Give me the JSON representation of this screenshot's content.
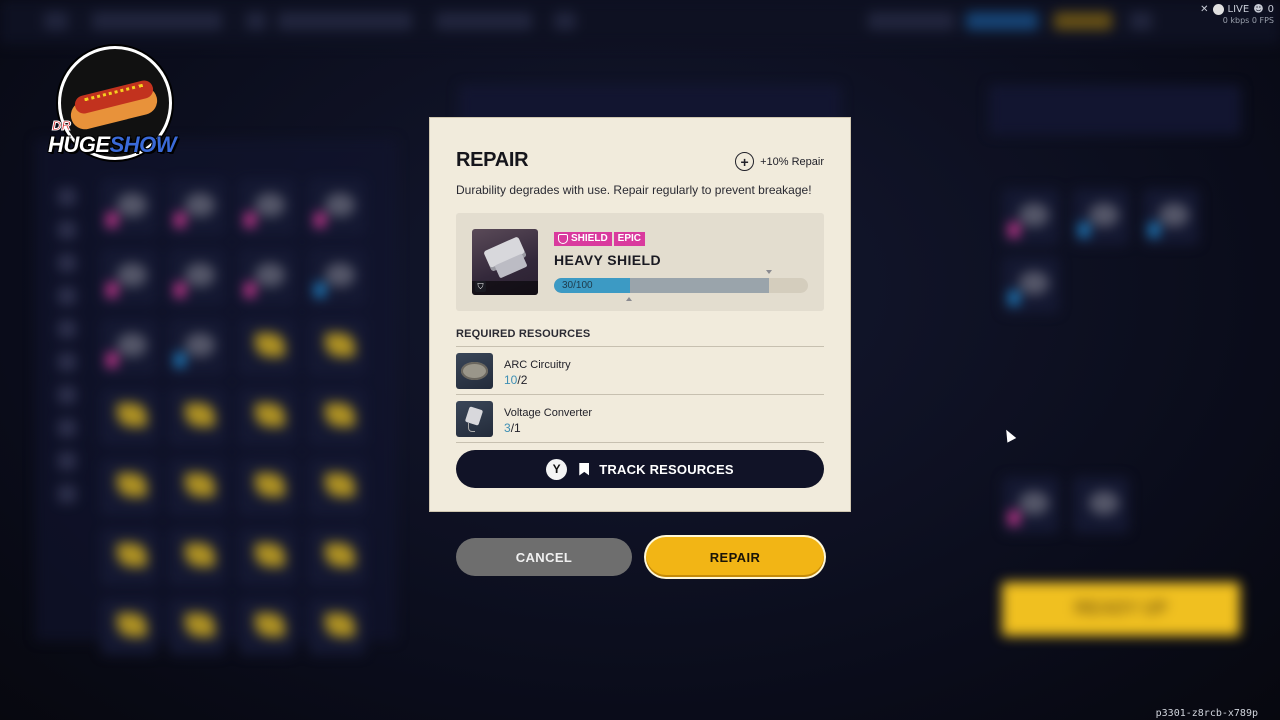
{
  "overlay": {
    "live_label": "LIVE",
    "viewer_count": "0",
    "stats": "0 kbps 0 FPS",
    "session_id": "p3301-z8rcb-x789p"
  },
  "logo": {
    "prefix": "DR",
    "name_part1": "HUGE",
    "name_part2": "SHOW"
  },
  "background": {
    "ready_label": "READY UP"
  },
  "modal": {
    "title": "REPAIR",
    "bonus_label": "+10% Repair",
    "description": "Durability degrades with use. Repair regularly to prevent breakage!",
    "item": {
      "tags": [
        "SHIELD",
        "EPIC"
      ],
      "name": "HEAVY SHIELD",
      "durability_text": "30/100",
      "durability_current": 30,
      "durability_max": 100,
      "durability_cap_fraction": 0.845,
      "accent_color": "#d93a9e"
    },
    "required_header": "REQUIRED RESOURCES",
    "resources": [
      {
        "name": "ARC Circuitry",
        "have": "10",
        "need": "2",
        "icon": "arc-circuitry-icon"
      },
      {
        "name": "Voltage Converter",
        "have": "3",
        "need": "1",
        "icon": "voltage-converter-icon"
      }
    ],
    "track_button": {
      "key": "Y",
      "label": "TRACK RESOURCES"
    }
  },
  "actions": {
    "cancel_label": "CANCEL",
    "repair_label": "REPAIR"
  },
  "colors": {
    "modal_bg": "#f1ebdc",
    "durability_fill": "#3c9ac4",
    "repair_button": "#f2b515",
    "cancel_button": "#6e6e6e",
    "epic_tag": "#d93a9e"
  }
}
